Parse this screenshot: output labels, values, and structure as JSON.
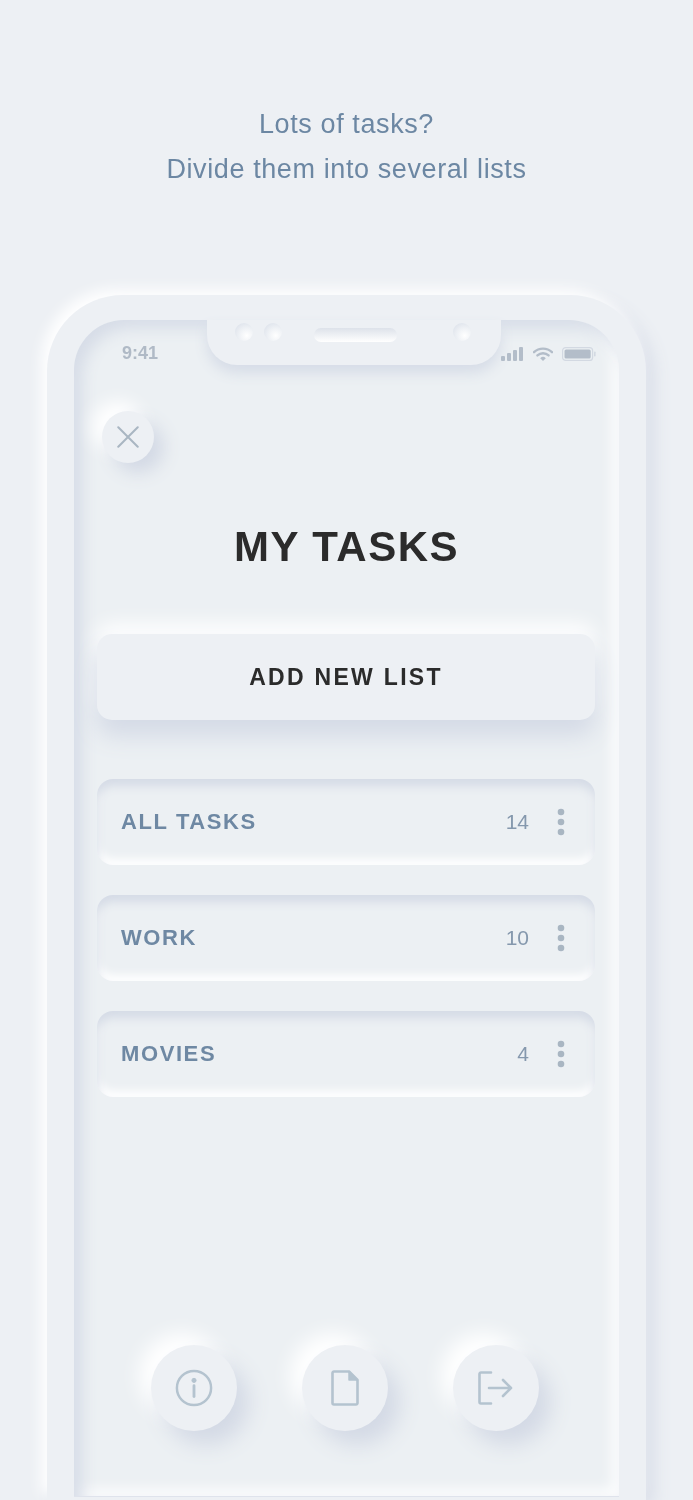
{
  "caption": {
    "lines": [
      "Lots of tasks?",
      "Divide them into several lists"
    ]
  },
  "status_bar": {
    "time": "9:41"
  },
  "header": {
    "title": "MY TASKS"
  },
  "add_button": {
    "label": "ADD NEW LIST"
  },
  "lists": [
    {
      "name": "ALL TASKS",
      "count": "14"
    },
    {
      "name": "WORK",
      "count": "10"
    },
    {
      "name": "MOVIES",
      "count": "4"
    }
  ]
}
